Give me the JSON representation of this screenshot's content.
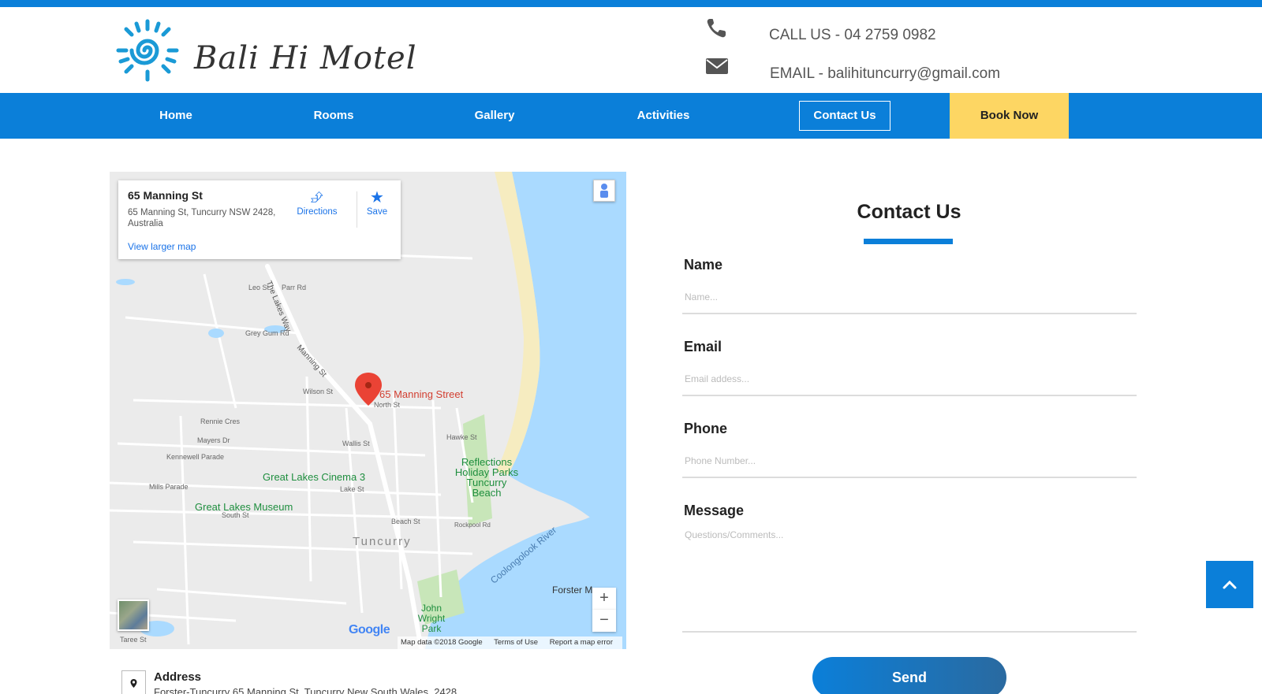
{
  "header": {
    "logo_text": "Bali Hi Motel",
    "phone_text": "CALL US - 04 2759 0982",
    "email_text": "EMAIL - balihituncurry@gmail.com",
    "icons": [
      "phone-icon",
      "envelope-icon",
      "sun-logo-icon"
    ]
  },
  "nav": {
    "items": [
      {
        "label": "Home"
      },
      {
        "label": "Rooms"
      },
      {
        "label": "Gallery"
      },
      {
        "label": "Activities"
      },
      {
        "label": "Contact Us"
      },
      {
        "label": "Book Now"
      }
    ],
    "active": "Contact Us"
  },
  "map": {
    "card": {
      "title": "65 Manning St",
      "address": "65 Manning St, Tuncurry NSW 2428, Australia",
      "directions_label": "Directions",
      "save_label": "Save",
      "larger_map_label": "View larger map"
    },
    "pin_label": "65 Manning Street",
    "places": [
      "Great Lakes Cinema 3",
      "Great Lakes Museum",
      "Reflections Holiday Parks Tuncurry Beach",
      "Tuncurry",
      "John Wright Park",
      "Forster M",
      "Coolongolook River"
    ],
    "streets": [
      "The Lakes Way",
      "Manning St",
      "Leo St",
      "Parr Rd",
      "Grey Gum Rd",
      "Wilson St",
      "North St",
      "Rennie Cres",
      "Mayers Dr",
      "Kennewell Parade",
      "Mills Parade",
      "South St",
      "Lake St",
      "Wallis St",
      "Hawke St",
      "Beach St",
      "Rockpool Rd",
      "Taree St"
    ],
    "google_logo": "Google",
    "footer": {
      "data": "Map data ©2018 Google",
      "terms": "Terms of Use",
      "report": "Report a map error"
    },
    "zoom_in": "+",
    "zoom_out": "−"
  },
  "address": {
    "label": "Address",
    "text": "Forster-Tuncurry 65 Manning St, Tuncurry New South Wales, 2428"
  },
  "form": {
    "title": "Contact Us",
    "fields": [
      {
        "label": "Name",
        "placeholder": "Name..."
      },
      {
        "label": "Email",
        "placeholder": "Email addess..."
      },
      {
        "label": "Phone",
        "placeholder": "Phone Number..."
      },
      {
        "label": "Message",
        "placeholder": "Questions/Comments..."
      }
    ],
    "send_label": "Send"
  },
  "colors": {
    "primary": "#0b7fd9",
    "book_now": "#fdd663",
    "map_water": "#aadaff",
    "map_land": "#ebebeb",
    "pin": "#ea4335"
  }
}
